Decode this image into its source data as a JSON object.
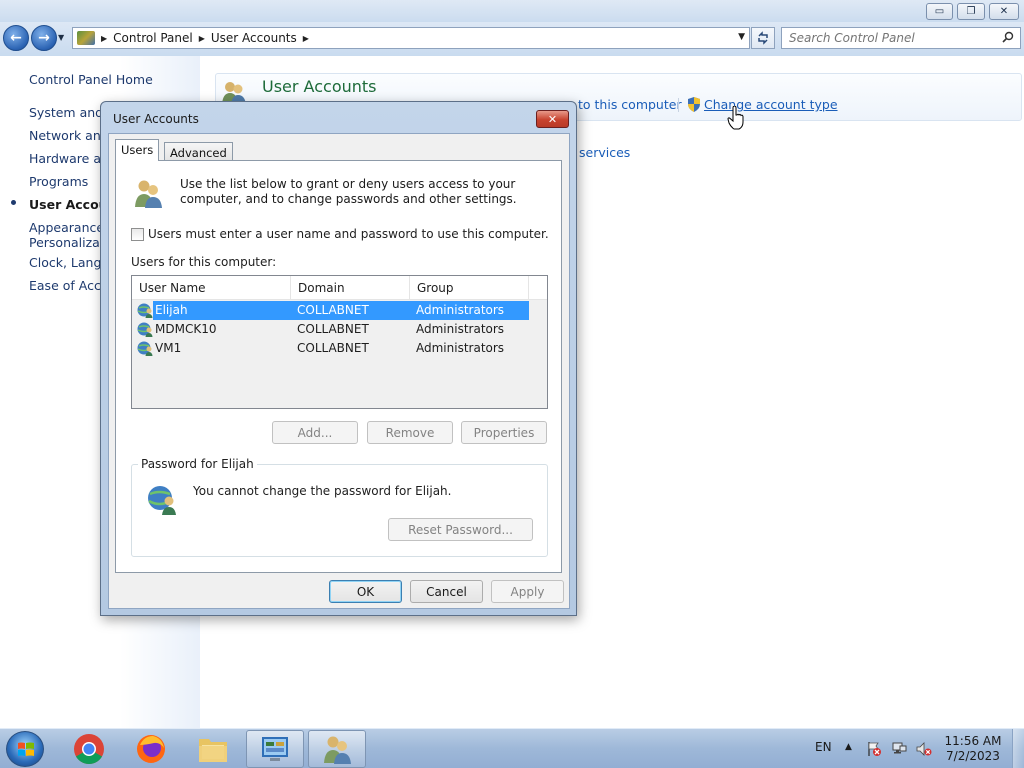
{
  "window": {
    "minimize": "▭",
    "maximize": "❐",
    "close": "✕"
  },
  "nav": {
    "back": "←",
    "forward": "→",
    "breadcrumb": [
      "Control Panel",
      "User Accounts"
    ],
    "search_placeholder": "Search Control Panel"
  },
  "sidebar": {
    "home": "Control Panel Home",
    "items": [
      {
        "label": "System and S",
        "selected": false
      },
      {
        "label": "Network and",
        "selected": false
      },
      {
        "label": "Hardware and",
        "selected": false
      },
      {
        "label": "Programs",
        "selected": false
      },
      {
        "label": "User Account",
        "selected": true
      },
      {
        "label": "Appearance a",
        "selected": false
      },
      {
        "label": "Personalizati",
        "selected": false
      },
      {
        "label": "Clock, Langua",
        "selected": false
      },
      {
        "label": "Ease of Acces",
        "selected": false
      }
    ]
  },
  "content": {
    "title": "User Accounts",
    "task_this_computer": "to this computer",
    "task_change_type": "Change account type",
    "task_services": "services"
  },
  "dialog": {
    "title": "User Accounts",
    "close": "✕",
    "tabs": [
      "Users",
      "Advanced"
    ],
    "intro": "Use the list below to grant or deny users access to your computer, and to change passwords and other settings.",
    "require_login_label": "Users must enter a user name and password to use this computer.",
    "require_login_checked": false,
    "users_label": "Users for this computer:",
    "columns": [
      "User Name",
      "Domain",
      "Group"
    ],
    "users": [
      {
        "name": "Elijah",
        "domain": "COLLABNET",
        "group": "Administrators",
        "selected": true
      },
      {
        "name": "MDMCK10",
        "domain": "COLLABNET",
        "group": "Administrators",
        "selected": false
      },
      {
        "name": "VM1",
        "domain": "COLLABNET",
        "group": "Administrators",
        "selected": false
      }
    ],
    "btn_add": "Add...",
    "btn_remove": "Remove",
    "btn_properties": "Properties",
    "password_group": "Password for Elijah",
    "password_msg": "You cannot change the password for Elijah.",
    "btn_reset": "Reset Password...",
    "btn_ok": "OK",
    "btn_cancel": "Cancel",
    "btn_apply": "Apply"
  },
  "taskbar": {
    "apps": [
      "chrome",
      "firefox",
      "file-explorer",
      "control-panel",
      "user-accounts"
    ],
    "active_apps": [
      "control-panel",
      "user-accounts"
    ],
    "language": "EN",
    "tray_up": "▲",
    "time": "11:56 AM",
    "date": "7/2/2023"
  }
}
